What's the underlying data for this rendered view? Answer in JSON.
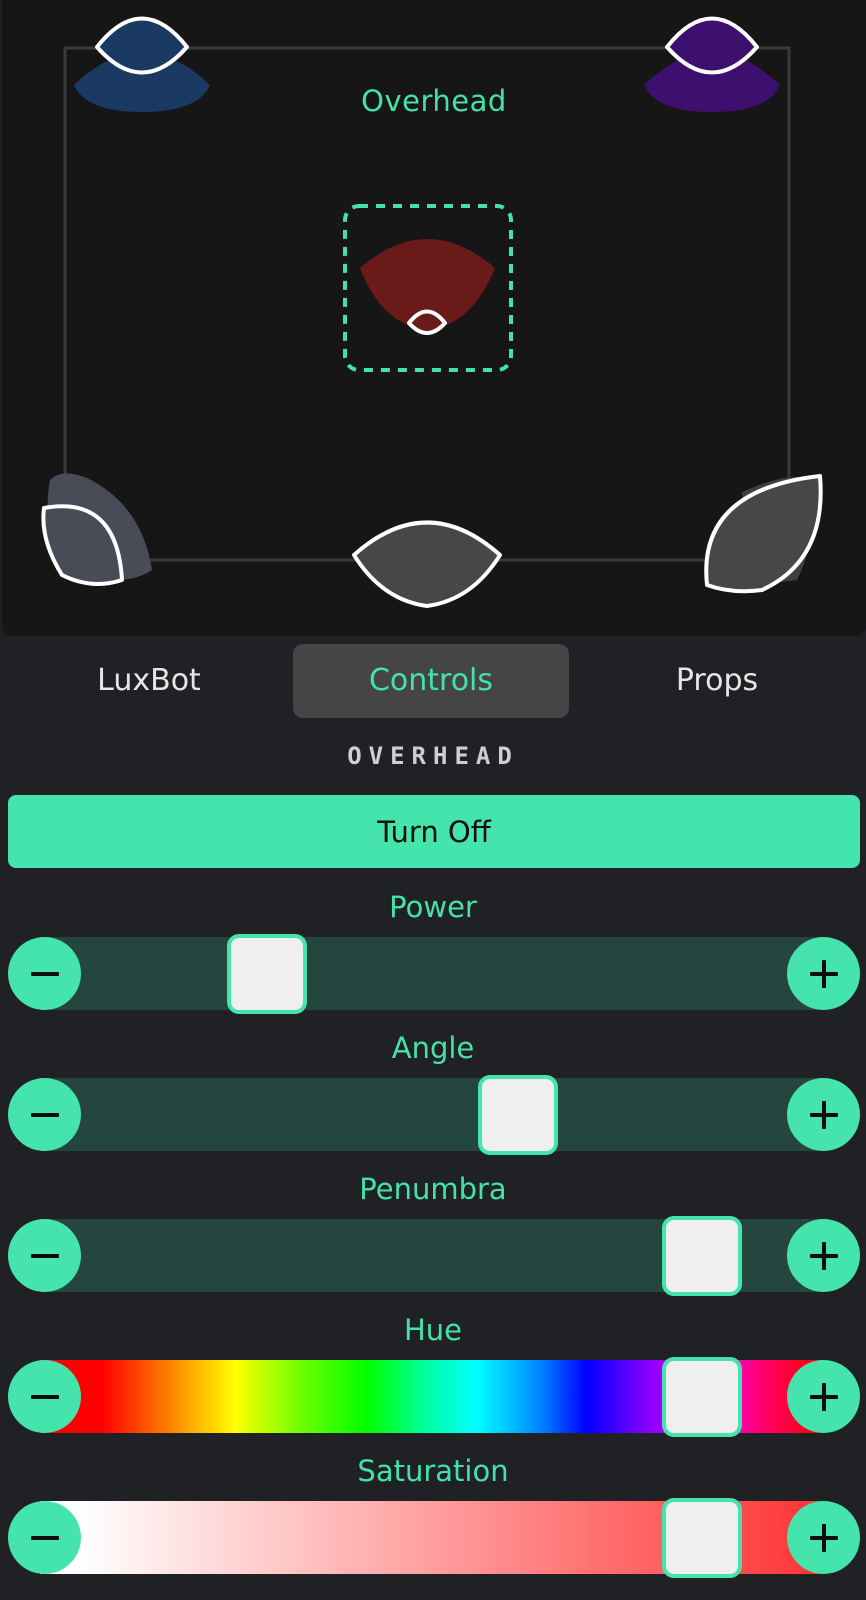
{
  "stage": {
    "selected_light_label": "Overhead",
    "colors": {
      "background": "#161616",
      "light_top_left": "#1b3a63",
      "light_top_right": "#3d1070",
      "light_overhead": "#6b1a1a",
      "light_neutral": "#474747",
      "selection_dash": "#44e2a9",
      "outline": "#ffffff"
    }
  },
  "tabs": [
    {
      "label": "LuxBot",
      "active": false
    },
    {
      "label": "Controls",
      "active": true
    },
    {
      "label": "Props",
      "active": false
    }
  ],
  "panel": {
    "section_title": "OVERHEAD",
    "toggle_label": "Turn Off",
    "accent": "#45e4ac"
  },
  "controls": [
    {
      "label": "Power",
      "value": 0.23,
      "track": "plain"
    },
    {
      "label": "Angle",
      "value": 0.61,
      "track": "plain"
    },
    {
      "label": "Penumbra",
      "value": 0.89,
      "track": "plain"
    },
    {
      "label": "Hue",
      "value": 0.89,
      "track": "hue"
    },
    {
      "label": "Saturation",
      "value": 0.89,
      "track": "sat"
    }
  ],
  "icons": {
    "decrease": "minus-icon",
    "increase": "plus-icon"
  }
}
